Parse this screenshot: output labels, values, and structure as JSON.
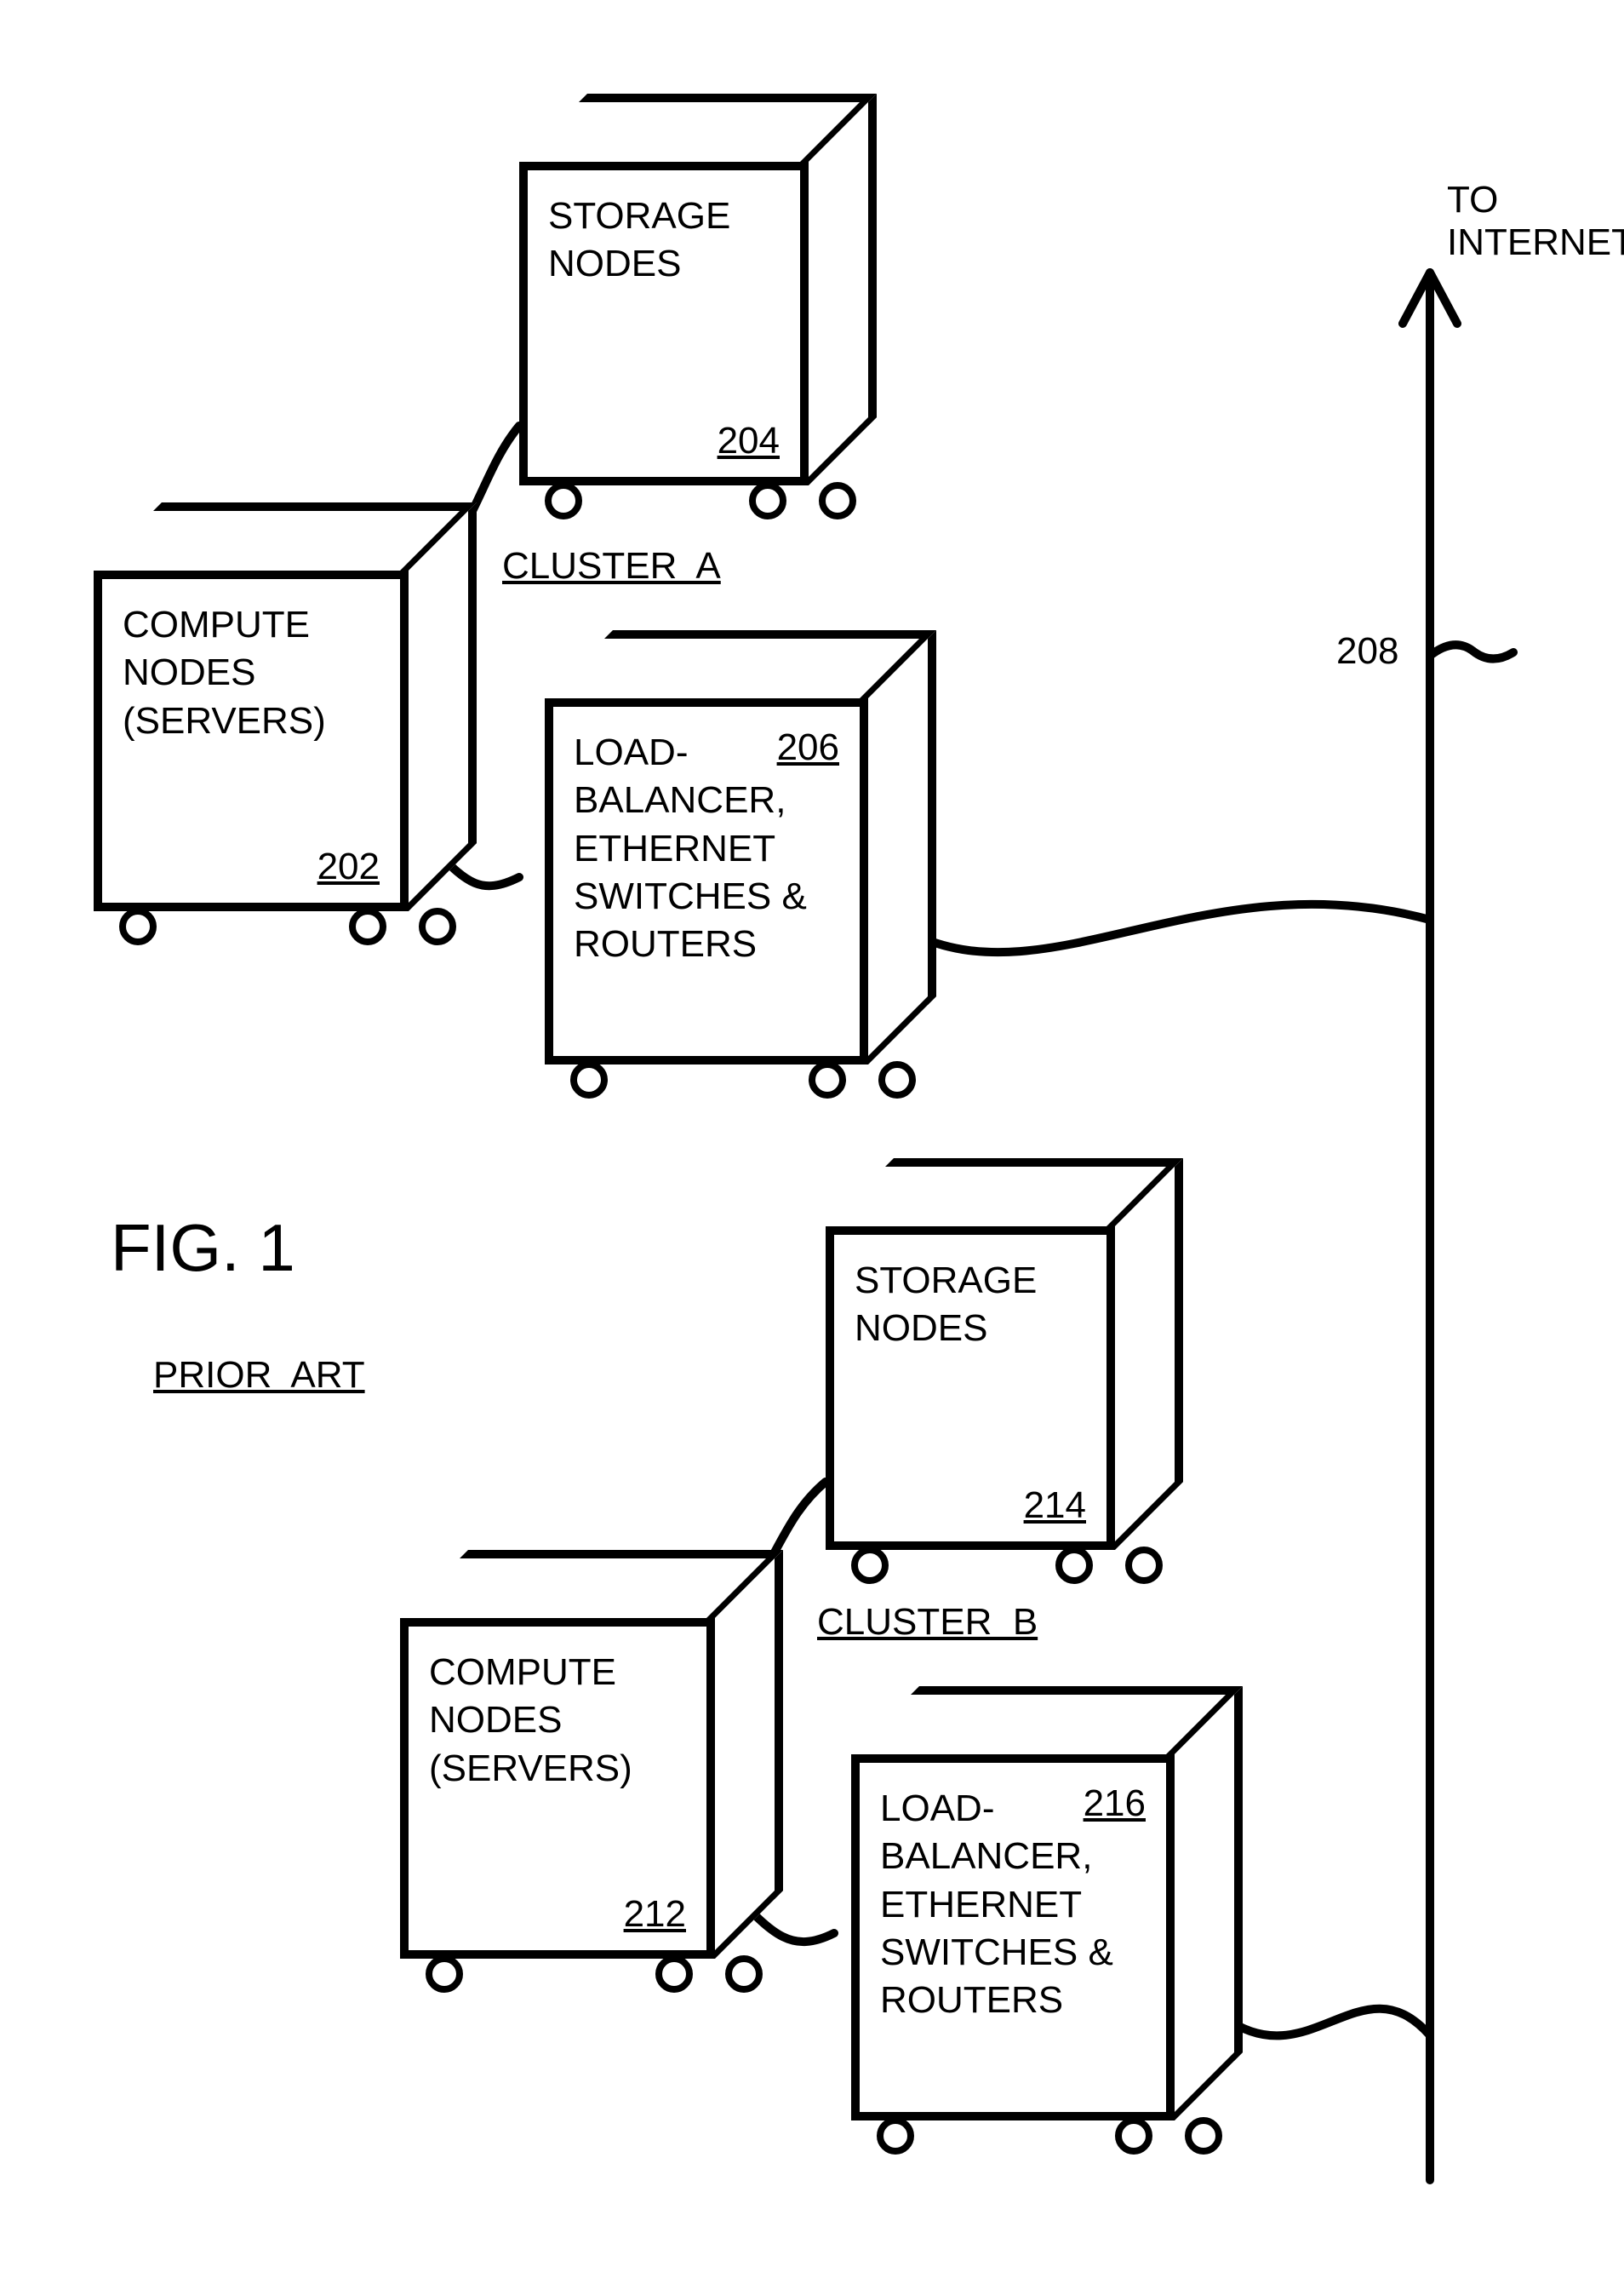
{
  "figure": {
    "title": "FIG. 1",
    "subtitle": "PRIOR  ART",
    "to_internet": "TO\nINTERNET",
    "ref_208": "208",
    "clusters": {
      "a": {
        "label": "CLUSTER  A",
        "compute": {
          "text": "COMPUTE\nNODES\n(SERVERS)",
          "ref": "202"
        },
        "storage": {
          "text": "STORAGE\nNODES",
          "ref": "204"
        },
        "net": {
          "text": "LOAD-\nBALANCER,\nETHERNET\nSWITCHES &\nROUTERS",
          "ref": "206"
        }
      },
      "b": {
        "label": "CLUSTER  B",
        "compute": {
          "text": "COMPUTE\nNODES\n(SERVERS)",
          "ref": "212"
        },
        "storage": {
          "text": "STORAGE\nNODES",
          "ref": "214"
        },
        "net": {
          "text": "LOAD-\nBALANCER,\nETHERNET\nSWITCHES &\nROUTERS",
          "ref": "216"
        }
      }
    }
  }
}
